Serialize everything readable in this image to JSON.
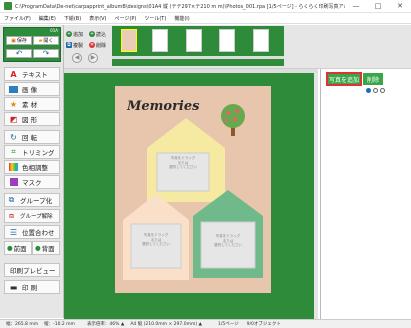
{
  "window": {
    "title": "C:\\ProgramData\\De-net\\carpapprint_albumB\\designs\\01A4 縦 (テテ297×テ210 m m)\\Photos_001.rpa [1/5ページ] - らくらく印刷写真アルバム作成 8",
    "minimize": "—",
    "maximize": "□",
    "close": "✕"
  },
  "menu": [
    "ファイル(F)",
    "編集(E)",
    "下絵(B)",
    "表示(V)",
    "ページ(P)",
    "ツール(T)",
    "機能(I)"
  ],
  "quick": {
    "tab_num": "01A",
    "save": "保存",
    "open": "開く",
    "undo": "↶",
    "redo": "↷"
  },
  "tools": {
    "text": "テキスト",
    "image": "画 像",
    "material": "素 材",
    "shape": "図 形",
    "rotate": "回 転",
    "trim": "トリミング",
    "color_adjust": "色相調整",
    "mask": "マスク",
    "group": "グループ化",
    "ungroup": "グループ解除",
    "align": "位置合わせ",
    "front": "前面",
    "back": "背面",
    "print_preview": "印刷プレビュー",
    "print": "印 刷"
  },
  "page_ops": {
    "add": "追加",
    "load": "読込",
    "copy": "複製",
    "delete": "削除"
  },
  "canvas": {
    "title": "Memories",
    "placeholder_lines": [
      "写真をドラッグ",
      "または",
      "選択してください"
    ],
    "bg_color": "#2e8b3a",
    "page_color": "#e8c6ad"
  },
  "right": {
    "add_photo": "写真を追加",
    "delete": "削除"
  },
  "status": {
    "width": "幅：265.8 mm",
    "height": "縦：-10.2 mm",
    "zoom": "表示倍率：46% ▲",
    "paper": "A4 縦 (210.0mm × 297.0mm) ▲",
    "page": "1/5ページ",
    "layer": "9/0オブジェクト"
  }
}
